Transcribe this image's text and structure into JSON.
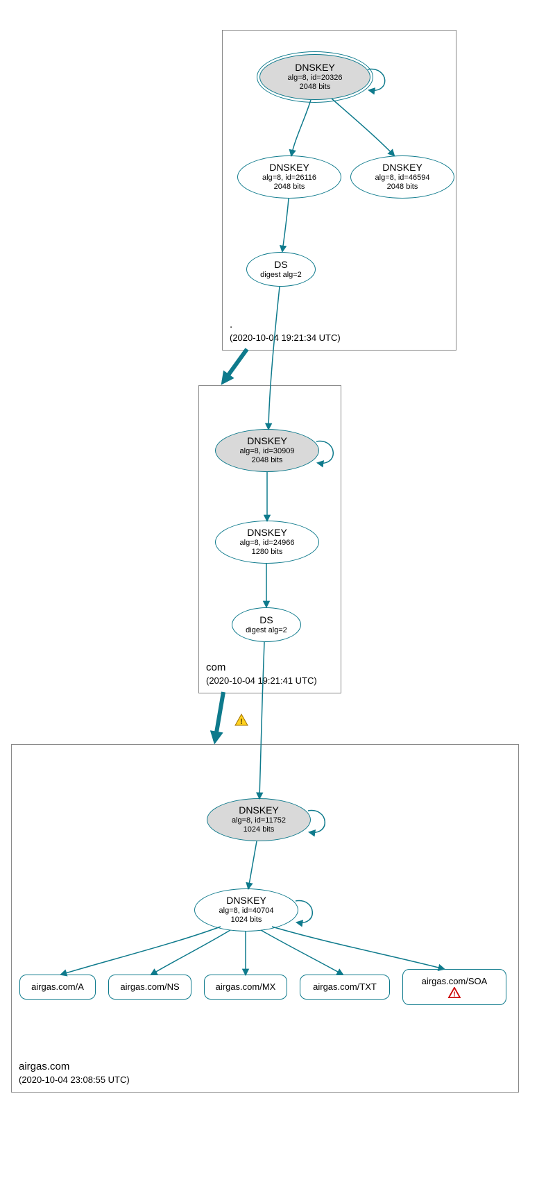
{
  "zones": {
    "root": {
      "name": ".",
      "timestamp": "(2020-10-04 19:21:34 UTC)",
      "dnskey_ksk": {
        "title": "DNSKEY",
        "alg": "alg=8, id=20326",
        "bits": "2048 bits"
      },
      "dnskey_zsk": {
        "title": "DNSKEY",
        "alg": "alg=8, id=26116",
        "bits": "2048 bits"
      },
      "dnskey_extra": {
        "title": "DNSKEY",
        "alg": "alg=8, id=46594",
        "bits": "2048 bits"
      },
      "ds": {
        "title": "DS",
        "digest": "digest alg=2"
      }
    },
    "com": {
      "name": "com",
      "timestamp": "(2020-10-04 19:21:41 UTC)",
      "dnskey_ksk": {
        "title": "DNSKEY",
        "alg": "alg=8, id=30909",
        "bits": "2048 bits"
      },
      "dnskey_zsk": {
        "title": "DNSKEY",
        "alg": "alg=8, id=24966",
        "bits": "1280 bits"
      },
      "ds": {
        "title": "DS",
        "digest": "digest alg=2"
      }
    },
    "airgas": {
      "name": "airgas.com",
      "timestamp": "(2020-10-04 23:08:55 UTC)",
      "dnskey_ksk": {
        "title": "DNSKEY",
        "alg": "alg=8, id=11752",
        "bits": "1024 bits"
      },
      "dnskey_zsk": {
        "title": "DNSKEY",
        "alg": "alg=8, id=40704",
        "bits": "1024 bits"
      },
      "rr_a": "airgas.com/A",
      "rr_ns": "airgas.com/NS",
      "rr_mx": "airgas.com/MX",
      "rr_txt": "airgas.com/TXT",
      "rr_soa": "airgas.com/SOA"
    }
  },
  "colors": {
    "edge": "#0e7a8c",
    "ksk_fill": "#d9d9d9"
  },
  "icons": {
    "warning": "yellow-triangle-exclaim",
    "error": "red-triangle-exclaim"
  }
}
